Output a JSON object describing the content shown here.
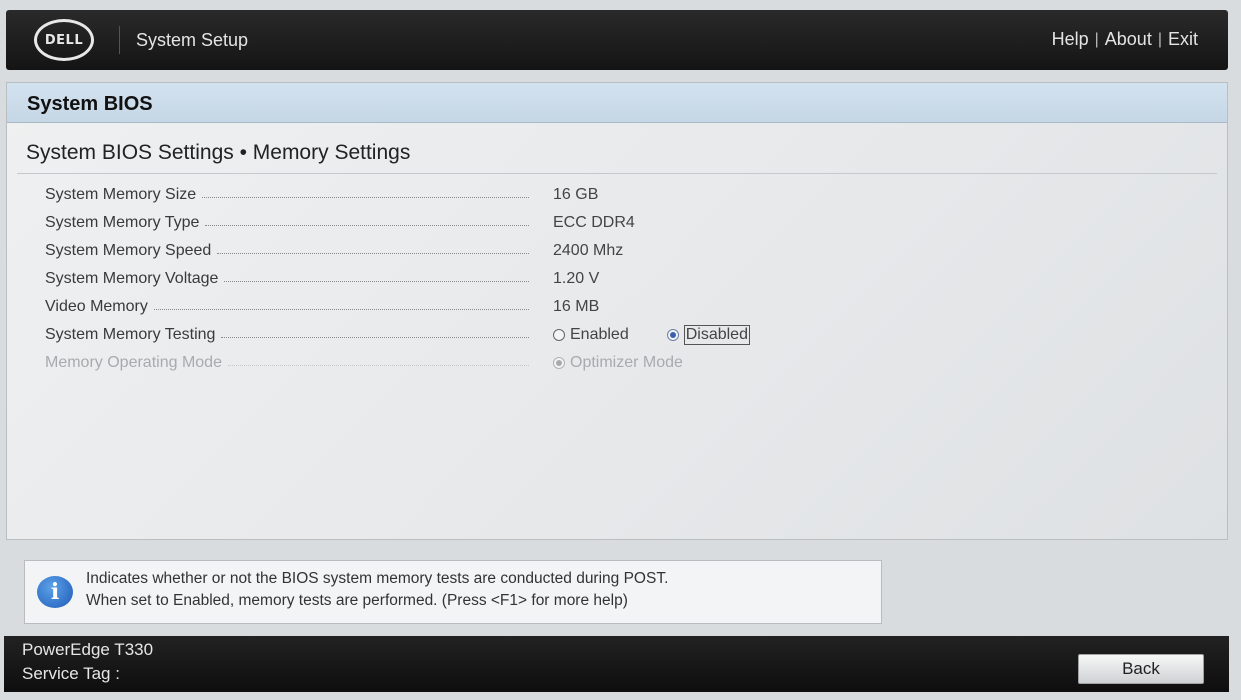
{
  "header": {
    "logo_text": "DELL",
    "app_title": "System Setup",
    "links": [
      "Help",
      "About",
      "Exit"
    ],
    "link_separator": "|"
  },
  "panel": {
    "title": "System BIOS",
    "subtitle": "System BIOS Settings • Memory Settings"
  },
  "settings": [
    {
      "label": "System Memory Size",
      "value": "16 GB"
    },
    {
      "label": "System Memory Type",
      "value": "ECC DDR4"
    },
    {
      "label": "System Memory Speed",
      "value": "2400 Mhz"
    },
    {
      "label": "System Memory Voltage",
      "value": "1.20 V"
    },
    {
      "label": "Video Memory",
      "value": "16 MB"
    }
  ],
  "memory_testing": {
    "label": "System Memory Testing",
    "options": [
      "Enabled",
      "Disabled"
    ],
    "selected": "Disabled"
  },
  "operating_mode": {
    "label": "Memory Operating Mode",
    "option": "Optimizer Mode"
  },
  "help": {
    "line1": "Indicates whether or not the BIOS system memory tests are conducted during POST.",
    "line2": "When set to Enabled, memory tests are performed. (Press <F1> for more help)",
    "icon": "info-icon"
  },
  "footer": {
    "model": "PowerEdge T330",
    "service_tag_label": "Service Tag :",
    "back_label": "Back"
  },
  "colors": {
    "header_bg": "#1a1a1a",
    "panel_head_bg": "#cddcea",
    "radio_selected": "#3b5fae"
  }
}
